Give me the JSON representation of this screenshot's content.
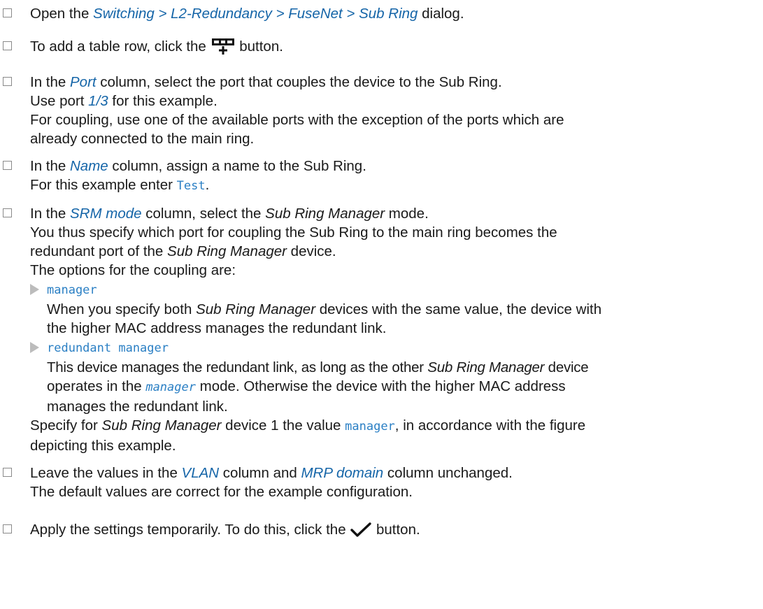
{
  "steps": [
    {
      "pre": "Open the ",
      "path": "Switching > L2-Redundancy > FuseNet > Sub Ring",
      "post": " dialog."
    },
    {
      "pre": "To add a table row, click the ",
      "icon": "add-table-row-icon",
      "post": " button."
    },
    {
      "l1_pre": "In the ",
      "l1_ui": "Port",
      "l1_post": " column, select the port that couples the device to the Sub Ring.",
      "l2_pre": "Use port ",
      "l2_ui": "1/3",
      "l2_post": " for this example.",
      "l3": "For coupling, use one of the available ports with the exception of the ports which are",
      "l4": "already connected to the main ring."
    },
    {
      "l1_pre": "In the ",
      "l1_ui": "Name",
      "l1_post": " column, assign a name to the Sub Ring.",
      "l2_pre": "For this example enter ",
      "l2_code": "Test",
      "l2_post": "."
    },
    {
      "l1_pre": "In the ",
      "l1_ui": "SRM mode",
      "l1_post": " column, select the ",
      "l1_em": "Sub Ring Manager",
      "l1_post2": " mode.",
      "l2": "You thus specify which port for coupling the Sub Ring to the main ring becomes the",
      "l3_pre": "redundant port of the ",
      "l3_em": "Sub Ring Manager",
      "l3_post": " device.",
      "l4": "The options for the coupling are:",
      "options": [
        {
          "code": "manager",
          "d1_pre": "When you specify both ",
          "d1_em": "Sub Ring Manager",
          "d1_post": " devices with the same value, the device with",
          "d2": "the higher MAC address manages the redundant link."
        },
        {
          "code": "redundant manager",
          "d1_pre": "This device manages the redundant link, as long as the other ",
          "d1_em": "Sub Ring Manager",
          "d1_post": " device",
          "d2_pre": "operates in the ",
          "d2_code": "manager",
          "d2_post": " mode. Otherwise the device with the higher MAC address",
          "d3": "manages the redundant link."
        }
      ],
      "l5_pre": "Specify for ",
      "l5_em": "Sub Ring Manager",
      "l5_mid": " device 1 the value ",
      "l5_code": "manager",
      "l5_post": ", in accordance with the figure",
      "l6": "depicting this example."
    },
    {
      "l1_pre": "Leave the values in the ",
      "l1_ui": "VLAN",
      "l1_mid": " column and ",
      "l1_ui2": "MRP domain",
      "l1_post": " column unchanged.",
      "l2": "The default values are correct for the example configuration."
    },
    {
      "pre": "Apply the settings temporarily. To do this, click the ",
      "icon": "checkmark-icon",
      "post": " button."
    }
  ],
  "colors": {
    "ui_element": "#1565a8",
    "code": "#2a7fc4",
    "checkbox_border": "#8a8a8a",
    "bullet_arrow": "#bcbcbc",
    "text": "#1a1a1a"
  }
}
